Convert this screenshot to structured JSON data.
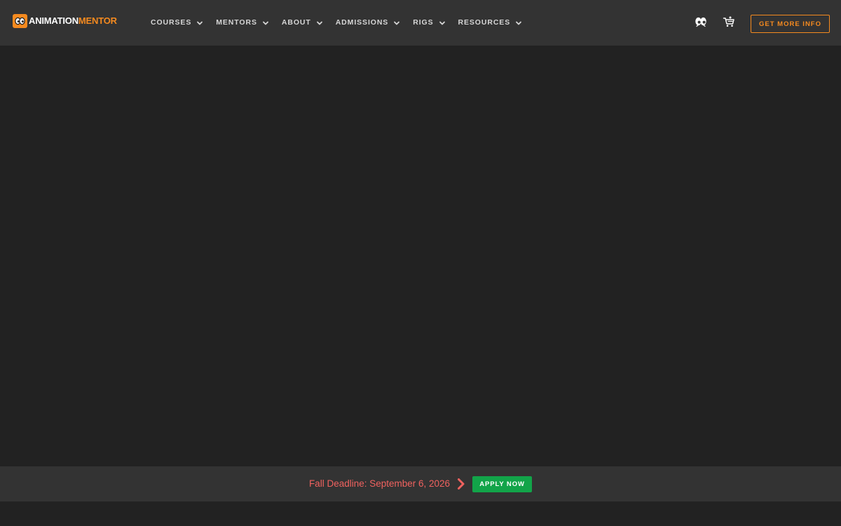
{
  "brand": {
    "name_part1": "ANIMATION",
    "name_part2": "MENTOR",
    "icon": "eyes-logo-icon"
  },
  "nav": {
    "items": [
      {
        "label": "COURSES"
      },
      {
        "label": "MENTORS"
      },
      {
        "label": "ABOUT"
      },
      {
        "label": "ADMISSIONS"
      },
      {
        "label": "RIGS"
      },
      {
        "label": "RESOURCES"
      }
    ]
  },
  "header_actions": {
    "account_icon": "eyes-icon",
    "cart_icon": "cart-icon",
    "cta_label": "GET MORE INFO"
  },
  "deadline": {
    "text": "Fall Deadline: September 6, 2026",
    "apply_label": "APPLY NOW"
  },
  "colors": {
    "accent": "#f58a1f",
    "header_bg": "#333333",
    "page_bg": "#222222",
    "deadline_text": "#f0625f",
    "apply_green": "#12a449"
  }
}
